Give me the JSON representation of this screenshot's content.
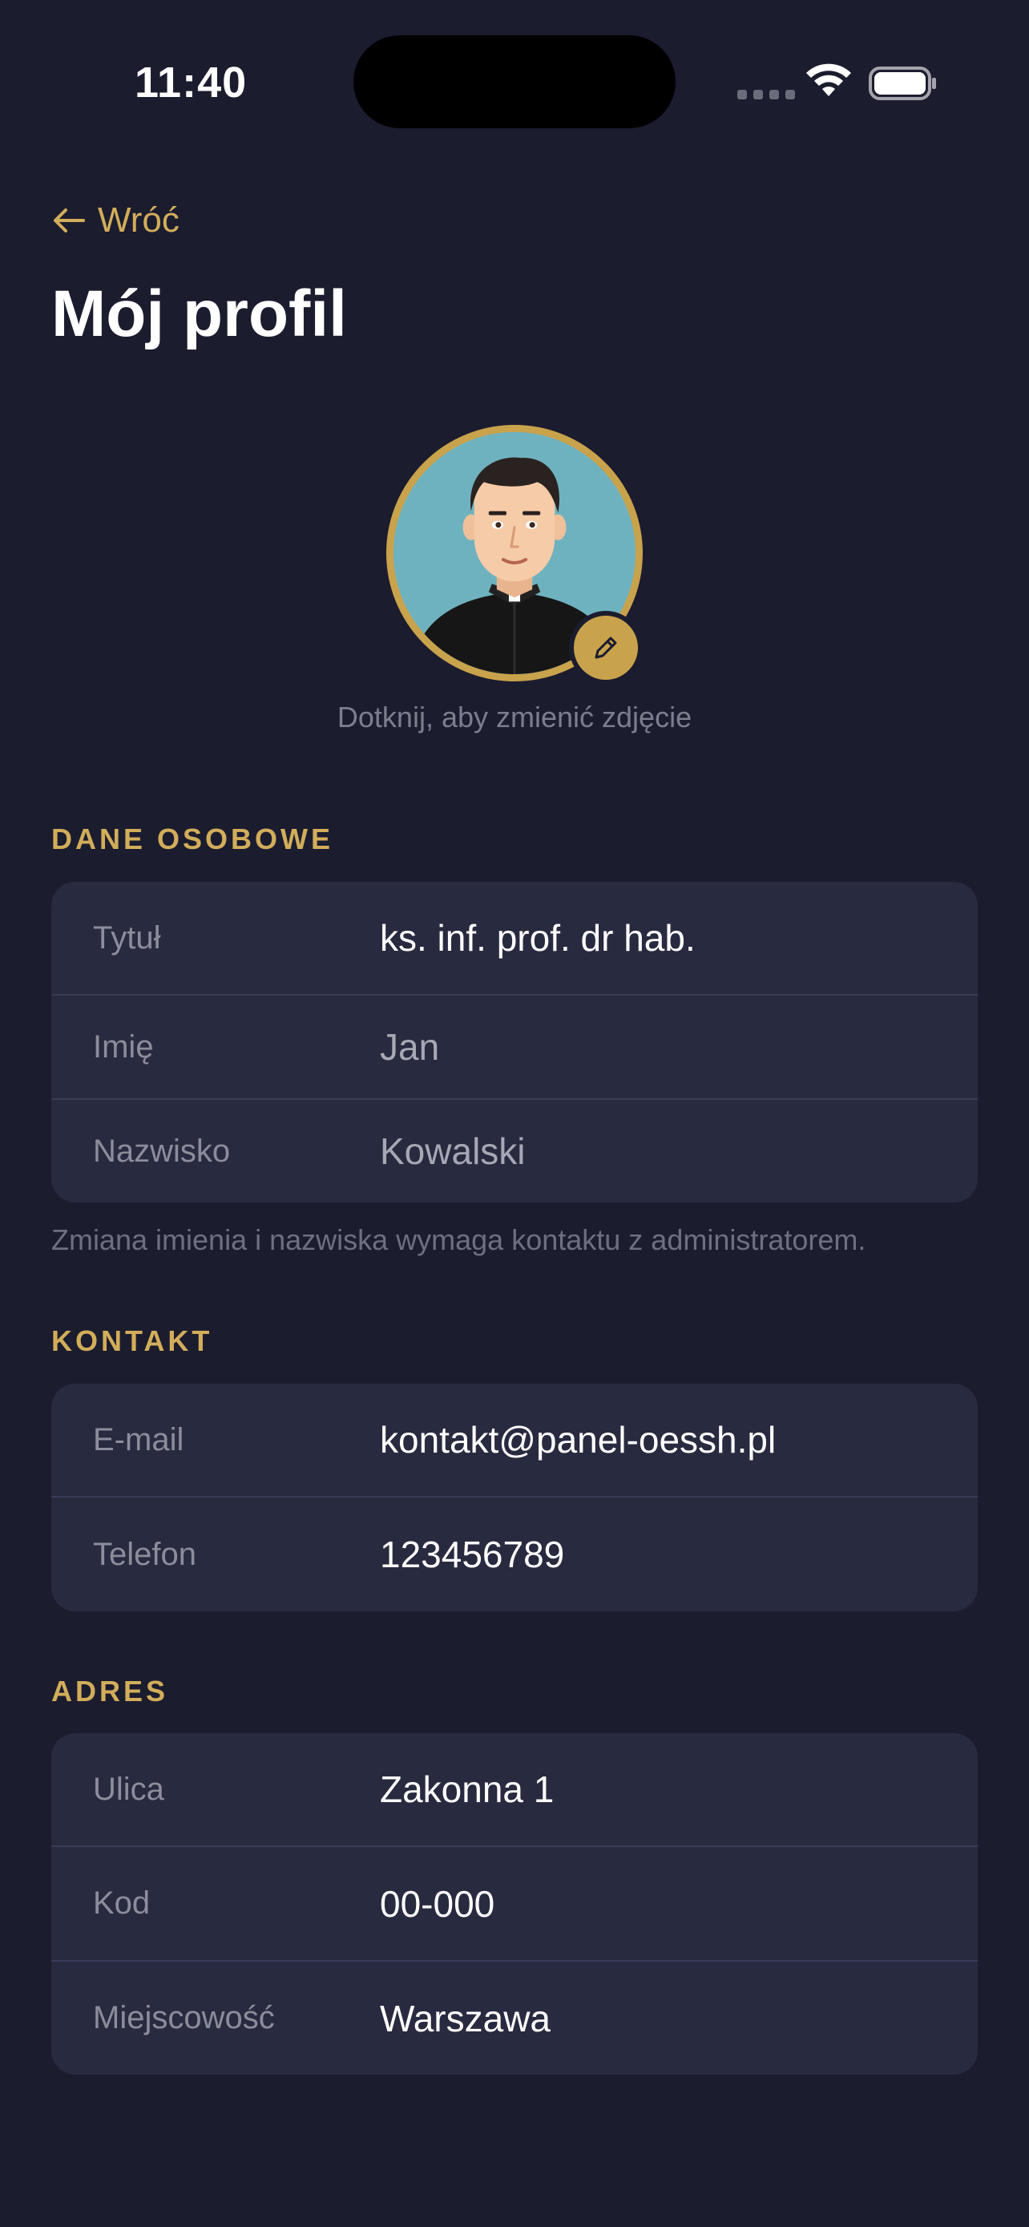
{
  "status_bar": {
    "time": "11:40"
  },
  "nav": {
    "back_label": "Wróć",
    "title": "Mój profil"
  },
  "avatar": {
    "hint": "Dotknij, aby zmienić zdjęcie",
    "ring_color": "#c9a24c",
    "edit_icon": "pencil-icon"
  },
  "sections": {
    "personal": {
      "title": "DANE OSOBOWE",
      "rows": [
        {
          "label": "Tytuł",
          "value": "ks. inf. prof. dr hab."
        },
        {
          "label": "Imię",
          "value": "Jan"
        },
        {
          "label": "Nazwisko",
          "value": "Kowalski"
        }
      ],
      "note": "Zmiana imienia i nazwiska wymaga kontaktu z administratorem."
    },
    "contact": {
      "title": "KONTAKT",
      "rows": [
        {
          "label": "E-mail",
          "value": "kontakt@panel-oessh.pl"
        },
        {
          "label": "Telefon",
          "value": "123456789"
        }
      ]
    },
    "address": {
      "title": "ADRES",
      "rows": [
        {
          "label": "Ulica",
          "value": "Zakonna 1"
        },
        {
          "label": "Kod",
          "value": "00-000"
        },
        {
          "label": "Miejscowość",
          "value": "Warszawa"
        }
      ]
    }
  },
  "colors": {
    "background": "#1b1c2e",
    "card": "#282a3f",
    "accent": "#d2ad5a",
    "label": "#8c8d9c"
  }
}
